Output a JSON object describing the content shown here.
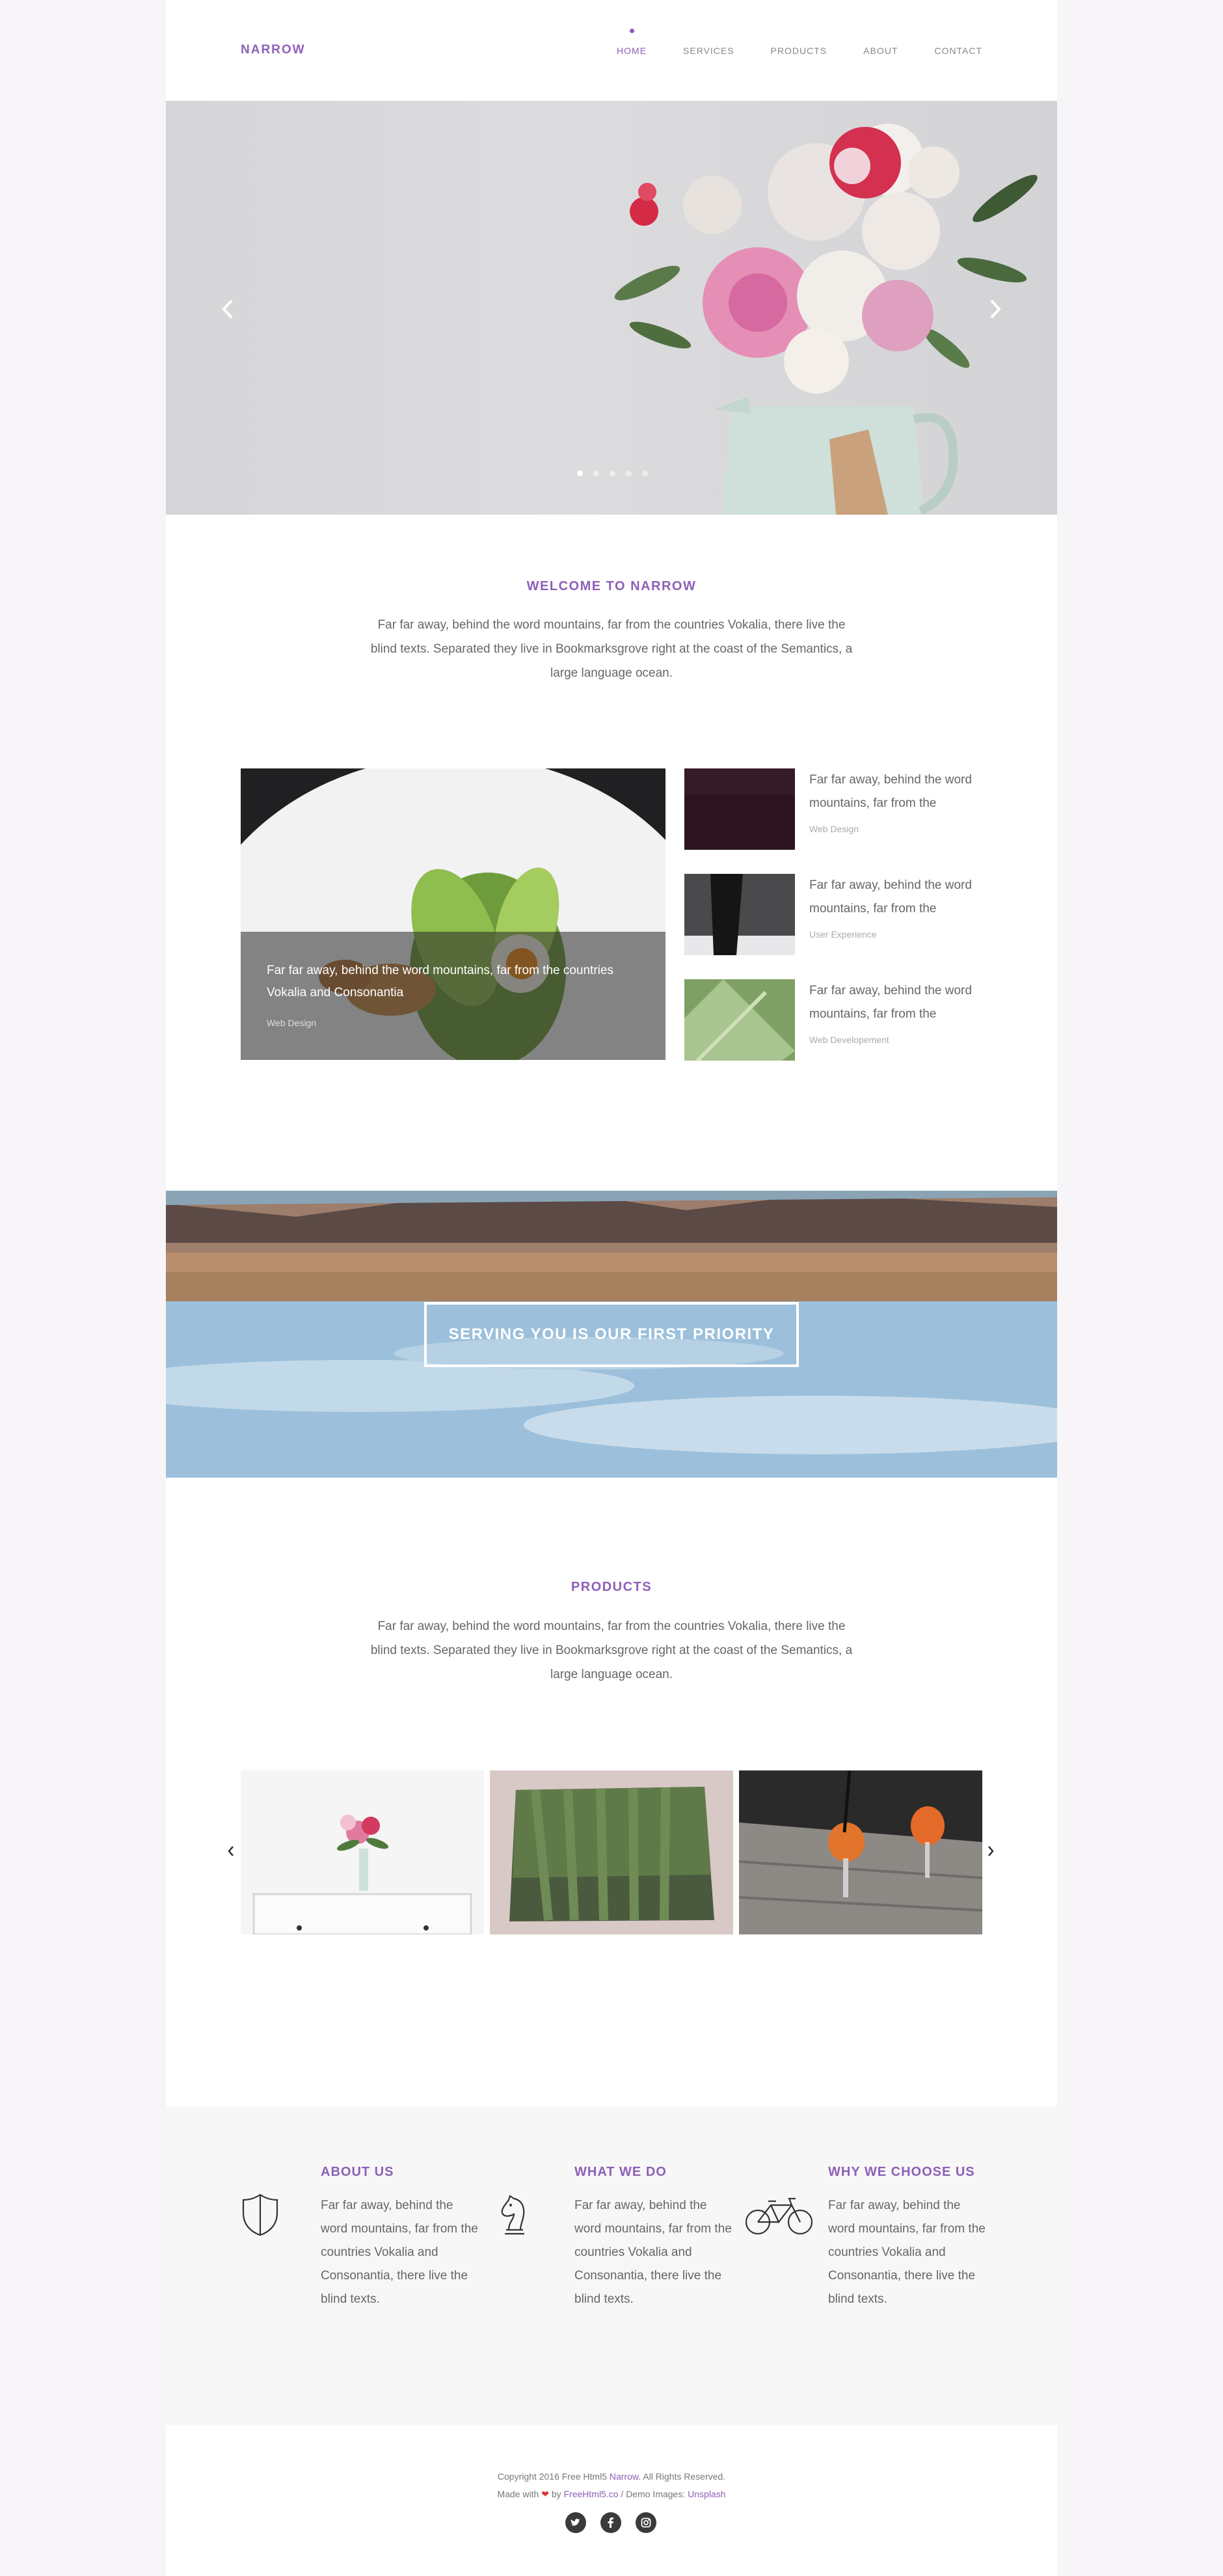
{
  "brand": {
    "logo": "NARROW",
    "accent_color": "#8e5fb8"
  },
  "nav": {
    "items": [
      {
        "label": "HOME",
        "active": true
      },
      {
        "label": "SERVICES",
        "active": false
      },
      {
        "label": "PRODUCTS",
        "active": false
      },
      {
        "label": "ABOUT",
        "active": false
      },
      {
        "label": "CONTACT",
        "active": false
      }
    ]
  },
  "hero": {
    "slide_count": 5,
    "active_slide": 1,
    "prev_icon": "chevron-left-icon",
    "next_icon": "chevron-right-icon"
  },
  "welcome": {
    "title": "WELCOME TO NARROW",
    "text": "Far far away, behind the word mountains, far from the countries Vokalia, there live the blind texts. Separated they live in Bookmarksgrove right at the coast of the Semantics, a large language ocean."
  },
  "blog": {
    "featured": {
      "title": "Far far away, behind the word mountains, far from the countries Vokalia and Consonantia",
      "category": "Web Design"
    },
    "side_posts": [
      {
        "title": "Far far away, behind the word mountains, far from the",
        "category": "Web Design"
      },
      {
        "title": "Far far away, behind the word mountains, far from the",
        "category": "User Experience"
      },
      {
        "title": "Far far away, behind the word mountains, far from the",
        "category": "Web Developement"
      }
    ]
  },
  "banner": {
    "button_label": "SERVING YOU IS OUR FIRST PRIORITY"
  },
  "products": {
    "title": "PRODUCTS",
    "text": "Far far away, behind the word mountains, far from the countries Vokalia, there live the blind texts. Separated they live in Bookmarksgrove right at the coast of the Semantics, a large language ocean."
  },
  "features": [
    {
      "title": "ABOUT US",
      "icon": "shield-icon",
      "text": "Far far away, behind the word mountains, far from the countries Vokalia and Consonantia, there live the blind texts."
    },
    {
      "title": "WHAT WE DO",
      "icon": "chess-knight-icon",
      "text": "Far far away, behind the word mountains, far from the countries Vokalia and Consonantia, there live the blind texts."
    },
    {
      "title": "WHY WE CHOOSE US",
      "icon": "bicycle-icon",
      "text": "Far far away, behind the word mountains, far from the countries Vokalia and Consonantia, there live the blind texts."
    }
  ],
  "footer": {
    "copy_prefix": "Copyright 2016 Free Html5",
    "copy_link": "Narrow",
    "copy_suffix": ". All Rights Reserved.",
    "made_with": "Made with",
    "by": "by",
    "by_link": "FreeHtml5.co",
    "demo_images": "/ Demo Images:",
    "demo_link": "Unsplash",
    "socials": [
      "twitter-icon",
      "facebook-icon",
      "instagram-icon"
    ]
  }
}
